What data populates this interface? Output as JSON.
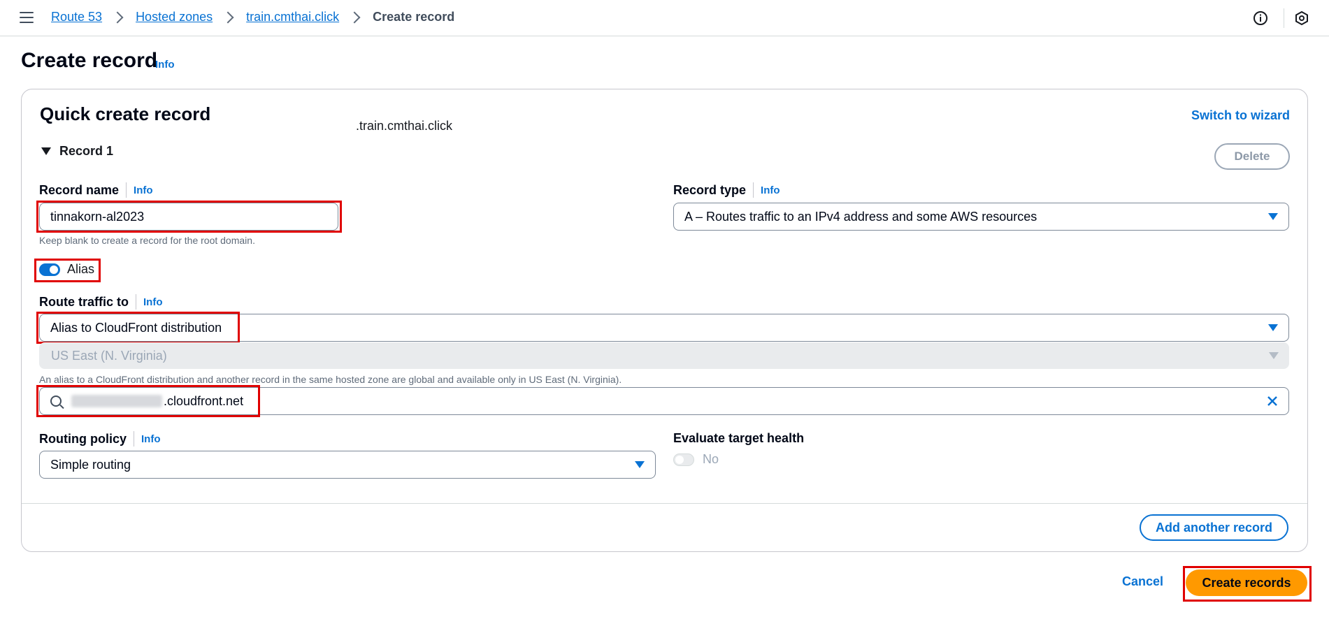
{
  "breadcrumb": {
    "items": [
      "Route 53",
      "Hosted zones",
      "train.cmthai.click"
    ],
    "current": "Create record"
  },
  "icons": {
    "menu": "hamburger-icon",
    "info": "info-circle-icon",
    "settings": "hexagon-settings-icon"
  },
  "page": {
    "title": "Create record",
    "info": "Info"
  },
  "panel": {
    "title": "Quick create record",
    "switch_wizard": "Switch to wizard",
    "record_section": "Record 1",
    "delete": "Delete"
  },
  "record_name": {
    "label": "Record name",
    "info": "Info",
    "value": "tinnakorn-al2023",
    "suffix": ".train.cmthai.click",
    "hint": "Keep blank to create a record for the root domain."
  },
  "record_type": {
    "label": "Record type",
    "info": "Info",
    "value": "A – Routes traffic to an IPv4 address and some AWS resources"
  },
  "alias": {
    "label": "Alias",
    "enabled": true
  },
  "route_traffic": {
    "label": "Route traffic to",
    "info": "Info",
    "endpoint": "Alias to CloudFront distribution",
    "region": "US East (N. Virginia)",
    "hint": "An alias to a CloudFront distribution and another record in the same hosted zone are global and available only in US East (N. Virginia).",
    "target_suffix": ".cloudfront.net"
  },
  "routing_policy": {
    "label": "Routing policy",
    "info": "Info",
    "value": "Simple routing"
  },
  "evaluate_health": {
    "label": "Evaluate target health",
    "value": "No"
  },
  "actions": {
    "add_another": "Add another record",
    "cancel": "Cancel",
    "create": "Create records"
  },
  "colors": {
    "link": "#0972d3",
    "primary": "#ff9900",
    "highlight": "#e00000"
  }
}
